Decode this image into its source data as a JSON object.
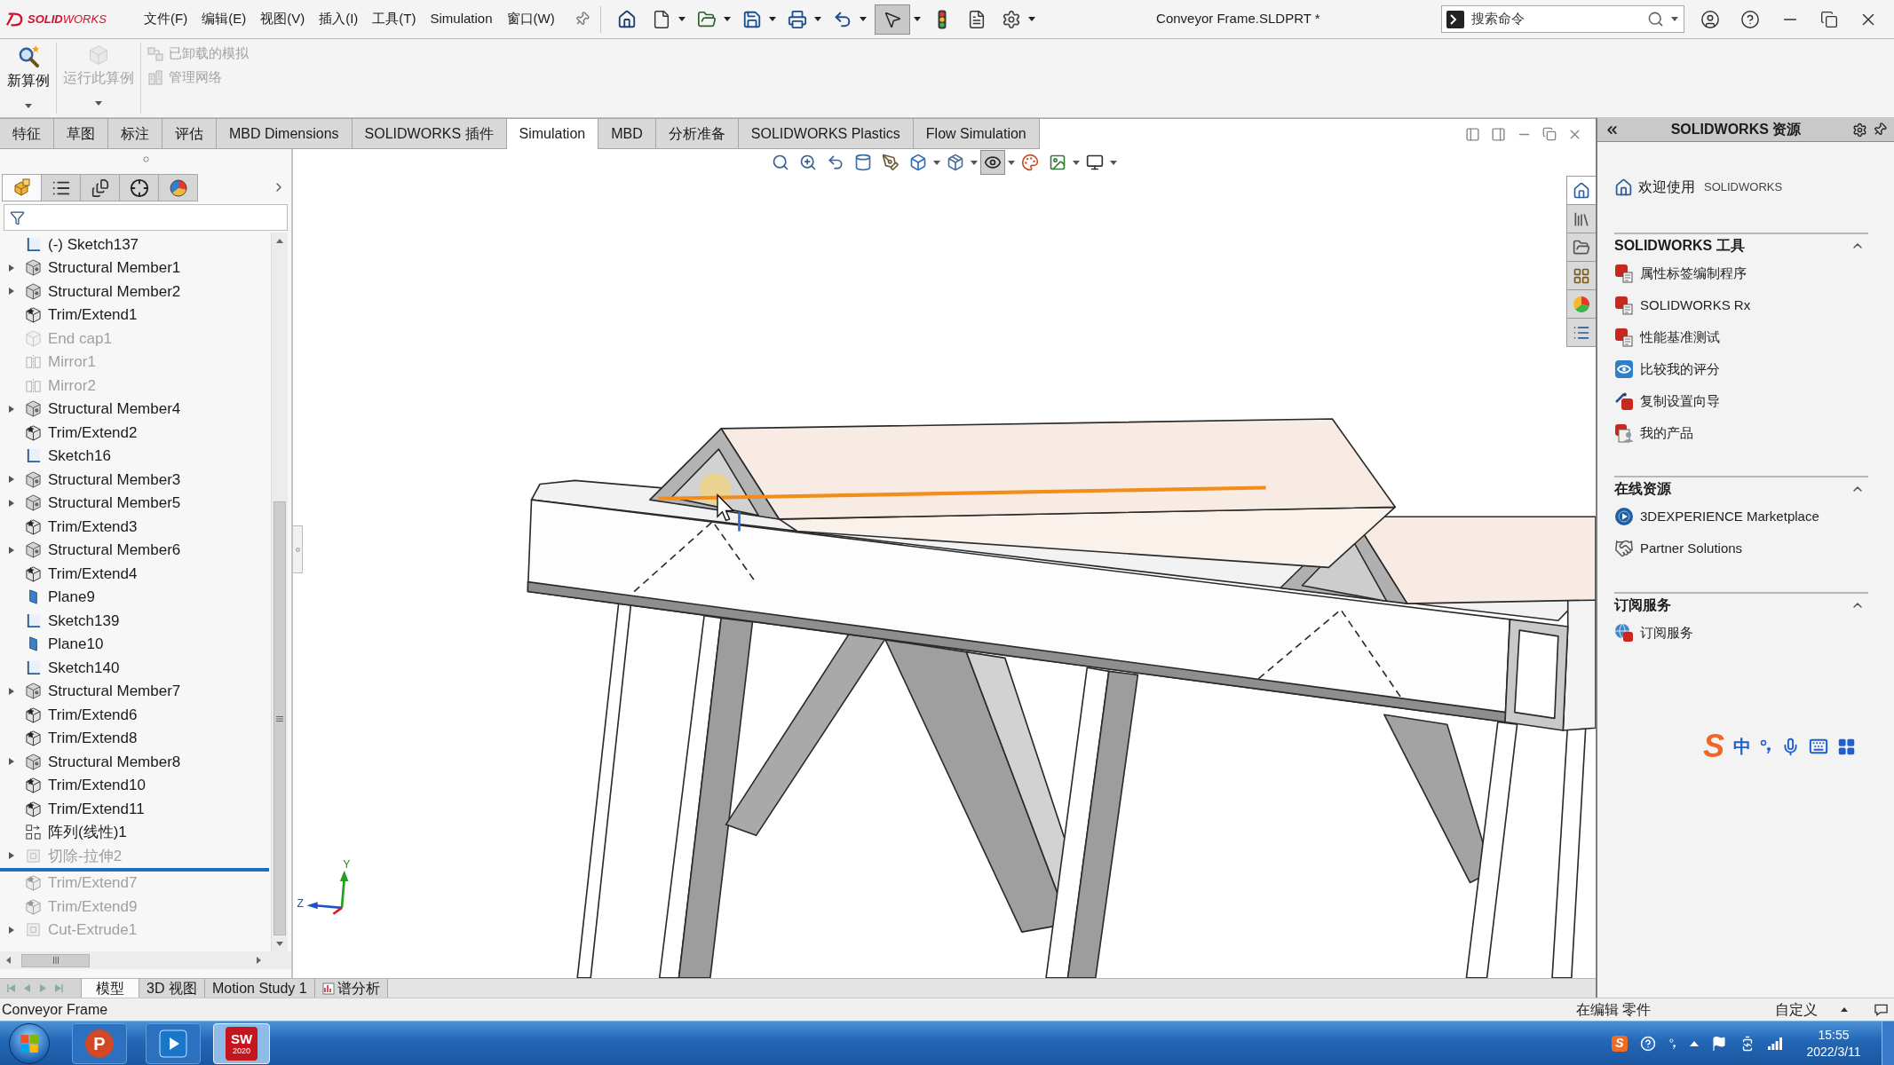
{
  "title_bar": {
    "logo": "**SOLID**WORKS",
    "menu": [
      "文件(F)",
      "编辑(E)",
      "视图(V)",
      "插入(I)",
      "工具(T)",
      "Simulation",
      "窗口(W)"
    ],
    "quick_access": [
      {
        "kind": "home",
        "dropdown": false,
        "selected": false
      },
      {
        "kind": "new",
        "dropdown": true,
        "selected": false
      },
      {
        "kind": "open",
        "dropdown": true,
        "selected": false
      },
      {
        "kind": "save",
        "dropdown": true,
        "selected": false
      },
      {
        "kind": "print",
        "dropdown": true,
        "selected": false
      },
      {
        "kind": "undo",
        "dropdown": true,
        "selected": false
      },
      {
        "kind": "select",
        "dropdown": true,
        "selected": true
      },
      {
        "kind": "rebuild",
        "dropdown": false,
        "selected": false
      },
      {
        "kind": "file_properties",
        "dropdown": false,
        "selected": false
      },
      {
        "kind": "options",
        "dropdown": true,
        "selected": false
      }
    ],
    "document_title": "Conveyor Frame.SLDPRT *",
    "search": {
      "placeholder": "搜索命令"
    }
  },
  "ribbon": {
    "large_buttons": [
      {
        "kind": "new_study",
        "label": "新算例",
        "disabled": false
      },
      {
        "kind": "run_study",
        "label": "运行此算例",
        "disabled": true
      }
    ],
    "small_buttons": [
      {
        "kind": "unloaded_simulations",
        "label": "已卸载的模拟",
        "disabled": true
      },
      {
        "kind": "manage_network",
        "label": "管理网络",
        "disabled": true
      }
    ]
  },
  "tabs": [
    {
      "label": "特征",
      "selected": false
    },
    {
      "label": "草图",
      "selected": false
    },
    {
      "label": "标注",
      "selected": false
    },
    {
      "label": "评估",
      "selected": false
    },
    {
      "label": "MBD Dimensions",
      "selected": false
    },
    {
      "label": "SOLIDWORKS 插件",
      "selected": false
    },
    {
      "label": "Simulation",
      "selected": true
    },
    {
      "label": "MBD",
      "selected": false
    },
    {
      "label": "分析准备",
      "selected": false
    },
    {
      "label": "SOLIDWORKS Plastics",
      "selected": false
    },
    {
      "label": "Flow Simulation",
      "selected": false
    }
  ],
  "feature_manager": {
    "panel_tabs": [
      {
        "kind": "feature_tree",
        "selected": true
      },
      {
        "kind": "property_manager",
        "selected": false
      },
      {
        "kind": "configuration_manager",
        "selected": false
      },
      {
        "kind": "dimxpert",
        "selected": false
      },
      {
        "kind": "display_manager",
        "selected": false
      }
    ],
    "tree": [
      {
        "kind": "sketch",
        "label": "(-) Sketch137",
        "expandable": false,
        "dimmed": false
      },
      {
        "kind": "structural_member",
        "label": "Structural Member1",
        "expandable": true,
        "dimmed": false
      },
      {
        "kind": "structural_member",
        "label": "Structural Member2",
        "expandable": true,
        "dimmed": false
      },
      {
        "kind": "trim_extend",
        "label": "Trim/Extend1",
        "expandable": false,
        "dimmed": false
      },
      {
        "kind": "end_cap",
        "label": "End cap1",
        "expandable": false,
        "dimmed": true
      },
      {
        "kind": "mirror",
        "label": "Mirror1",
        "expandable": false,
        "dimmed": true
      },
      {
        "kind": "mirror",
        "label": "Mirror2",
        "expandable": false,
        "dimmed": true
      },
      {
        "kind": "structural_member",
        "label": "Structural Member4",
        "expandable": true,
        "dimmed": false
      },
      {
        "kind": "trim_extend",
        "label": "Trim/Extend2",
        "expandable": false,
        "dimmed": false
      },
      {
        "kind": "sketch",
        "label": "Sketch16",
        "expandable": false,
        "dimmed": false
      },
      {
        "kind": "structural_member",
        "label": "Structural Member3",
        "expandable": true,
        "dimmed": false
      },
      {
        "kind": "structural_member",
        "label": "Structural Member5",
        "expandable": true,
        "dimmed": false
      },
      {
        "kind": "trim_extend",
        "label": "Trim/Extend3",
        "expandable": false,
        "dimmed": false
      },
      {
        "kind": "structural_member",
        "label": "Structural Member6",
        "expandable": true,
        "dimmed": false
      },
      {
        "kind": "trim_extend",
        "label": "Trim/Extend4",
        "expandable": false,
        "dimmed": false
      },
      {
        "kind": "plane",
        "label": "Plane9",
        "expandable": false,
        "dimmed": false
      },
      {
        "kind": "sketch",
        "label": "Sketch139",
        "expandable": false,
        "dimmed": false
      },
      {
        "kind": "plane",
        "label": "Plane10",
        "expandable": false,
        "dimmed": false
      },
      {
        "kind": "sketch",
        "label": "Sketch140",
        "expandable": false,
        "dimmed": false
      },
      {
        "kind": "structural_member",
        "label": "Structural Member7",
        "expandable": true,
        "dimmed": false
      },
      {
        "kind": "trim_extend",
        "label": "Trim/Extend6",
        "expandable": false,
        "dimmed": false
      },
      {
        "kind": "trim_extend",
        "label": "Trim/Extend8",
        "expandable": false,
        "dimmed": false
      },
      {
        "kind": "structural_member",
        "label": "Structural Member8",
        "expandable": true,
        "dimmed": false
      },
      {
        "kind": "trim_extend",
        "label": "Trim/Extend10",
        "expandable": false,
        "dimmed": false
      },
      {
        "kind": "trim_extend",
        "label": "Trim/Extend11",
        "expandable": false,
        "dimmed": false
      },
      {
        "kind": "pattern",
        "label": "阵列(线性)1",
        "expandable": false,
        "dimmed": false
      },
      {
        "kind": "cut",
        "label": "切除-拉伸2",
        "expandable": true,
        "dimmed": true
      },
      {
        "kind": "rollback_bar"
      },
      {
        "kind": "trim_extend",
        "label": "Trim/Extend7",
        "expandable": false,
        "dimmed": true
      },
      {
        "kind": "trim_extend",
        "label": "Trim/Extend9",
        "expandable": false,
        "dimmed": true
      },
      {
        "kind": "cut",
        "label": "Cut-Extrude1",
        "expandable": true,
        "dimmed": true
      }
    ]
  },
  "viewport": {
    "heads_up_toolbar": [
      {
        "kind": "zoom_to_fit",
        "dropdown": false,
        "selected": false
      },
      {
        "kind": "zoom_area",
        "dropdown": false,
        "selected": false
      },
      {
        "kind": "previous_view",
        "dropdown": false,
        "selected": false
      },
      {
        "kind": "section_view",
        "dropdown": false,
        "selected": false
      },
      {
        "kind": "dynamic_annotation",
        "dropdown": false,
        "selected": false
      },
      {
        "kind": "view_orientation",
        "dropdown": true,
        "selected": false
      },
      {
        "kind": "display_style",
        "dropdown": true,
        "selected": false
      },
      {
        "kind": "hide_show",
        "dropdown": true,
        "selected": true
      },
      {
        "kind": "edit_appearance",
        "dropdown": false,
        "selected": false
      },
      {
        "kind": "apply_scene",
        "dropdown": true,
        "selected": false
      },
      {
        "kind": "view_settings",
        "dropdown": true,
        "selected": false
      }
    ],
    "triad": {
      "y_label": "Y",
      "z_label": "Z"
    }
  },
  "task_pane": {
    "tabs": [
      {
        "kind": "home",
        "selected": true
      },
      {
        "kind": "design_library",
        "selected": false
      },
      {
        "kind": "file_explorer",
        "selected": false
      },
      {
        "kind": "view_palette",
        "selected": false
      },
      {
        "kind": "appearances",
        "selected": false
      },
      {
        "kind": "custom_properties",
        "selected": false
      }
    ],
    "title": "SOLIDWORKS 资源",
    "welcome": {
      "label": "欢迎使用",
      "product": "SOLIDWORKS"
    },
    "sections": [
      {
        "title": "SOLIDWORKS 工具",
        "expanded": true,
        "items": [
          {
            "kind": "property_tab_builder",
            "label": "属性标签编制程序"
          },
          {
            "kind": "rx",
            "label": "SOLIDWORKS Rx"
          },
          {
            "kind": "benchmark",
            "label": "性能基准测试"
          },
          {
            "kind": "compare_scores",
            "label": "比较我的评分"
          },
          {
            "kind": "copy_settings",
            "label": "复制设置向导"
          },
          {
            "kind": "my_products",
            "label": "我的产品"
          }
        ]
      },
      {
        "title": "在线资源",
        "expanded": true,
        "items": [
          {
            "kind": "marketplace",
            "label": "3DEXPERIENCE Marketplace"
          },
          {
            "kind": "partner",
            "label": "Partner Solutions"
          }
        ]
      },
      {
        "title": "订阅服务",
        "expanded": true,
        "items": [
          {
            "kind": "subscription",
            "label": "订阅服务"
          }
        ]
      }
    ]
  },
  "bottom_tabs": [
    {
      "kind": "plain",
      "label": "模型",
      "selected": true
    },
    {
      "kind": "plain",
      "label": "3D 视图",
      "selected": false
    },
    {
      "kind": "plain",
      "label": "Motion Study 1",
      "selected": false
    },
    {
      "kind": "study",
      "label": "谱分析",
      "selected": false
    }
  ],
  "status_bar": {
    "document": "Conveyor Frame",
    "mode": "在编辑 零件",
    "units": "自定义"
  },
  "ime_toolbar": {
    "logo": "S",
    "mode": "中"
  },
  "taskbar": {
    "apps": [
      {
        "kind": "start",
        "selected": false
      },
      {
        "kind": "powerpoint",
        "logo": "P",
        "selected": false
      },
      {
        "kind": "media_player",
        "selected": false
      },
      {
        "kind": "solidworks",
        "logo": "SW",
        "version": "2020",
        "selected": true
      }
    ],
    "tray": [
      {
        "kind": "ime",
        "logo": "S"
      },
      {
        "kind": "help"
      },
      {
        "kind": "ime_settings"
      },
      {
        "kind": "show_hidden"
      },
      {
        "kind": "action_center"
      },
      {
        "kind": "power"
      },
      {
        "kind": "network"
      }
    ],
    "time": "15:55",
    "date": "2022/3/11"
  }
}
